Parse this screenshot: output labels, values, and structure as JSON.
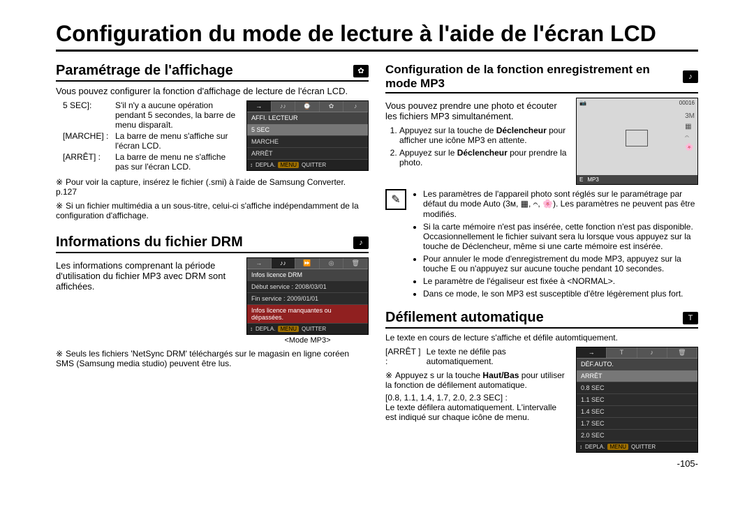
{
  "page_title": "Conﬁguration du mode de lecture à l'aide de l'écran LCD",
  "page_number": "-105-",
  "left": {
    "s1_head": "Paramétrage de l'afﬁchage",
    "s1_intro": "Vous pouvez configurer la fonction d'affichage de lecture de l'écran LCD.",
    "s1_opts": [
      {
        "lbl": "5 SEC]:",
        "val": "S'il n'y a aucune opération pendant 5 secondes, la barre de menu disparaît."
      },
      {
        "lbl": "[MARCHE] :",
        "val": "La barre de menu s'affiche sur l'écran LCD."
      },
      {
        "lbl": "[ARRÊT] :",
        "val": "La barre de menu ne s'affiche pas sur l'écran LCD."
      }
    ],
    "s1_screen": {
      "header": "AFFI. LECTEUR",
      "items": [
        "5 SEC",
        "MARCHE",
        "ARRÊT"
      ],
      "sel_index": 0,
      "footer_move": "DEPLA.",
      "footer_menu": "MENU",
      "footer_exit": "QUITTER"
    },
    "s1_notes": [
      "Pour voir la capture, insérez le fichier (.smi) à l'aide de Samsung Converter. p.127",
      "Si un fichier multimédia a un sous-titre, celui-ci s'affiche indépendamment de la configuration d'affichage."
    ],
    "s2_head": "Informations du ﬁchier DRM",
    "s2_intro": "Les informations comprenant la période d'utilisation du fichier MP3 avec DRM sont affichées.",
    "s2_screen": {
      "header": "Infos licence DRM",
      "items": [
        "Début service : 2008/03/01",
        "Fin service : 2009/01/01",
        "Infos licence manquantes ou dépassées."
      ],
      "footer_move": "DEPLA.",
      "footer_menu": "MENU",
      "footer_exit": "QUITTER"
    },
    "s2_caption": "<Mode MP3>",
    "s2_notes": [
      "Seuls les fichiers 'NetSync DRM' téléchargés sur le magasin en ligne coréen SMS (Samsung media studio) peuvent être lus."
    ]
  },
  "right": {
    "s3_head": "Conﬁguration de la fonction enregistrement en mode MP3",
    "s3_intro": "Vous pouvez prendre une photo et écouter les fichiers MP3 simultanément.",
    "s3_steps": [
      {
        "before": "Appuyez sur la touche de ",
        "bold": "Déclencheur",
        "after": " pour afficher une icône MP3 en attente."
      },
      {
        "before": "Appuyez sur le ",
        "bold": "Déclencheur",
        "after": " pour prendre la photo."
      }
    ],
    "s3_lcd": {
      "counter": "00016",
      "size": "3M",
      "bottom_e": "E",
      "bottom_mp3": "MP3"
    },
    "s3_info": [
      "Les paramètres de l'appareil photo sont réglés sur le paramétrage par défaut du mode Auto (3ᴍ, ▦, 𝄐, 🌸). Les paramètres ne peuvent pas être modifiés.",
      "Si la carte mémoire n'est pas insérée, cette fonction n'est pas disponible. Occasionnellement le fichier suivant sera lu lorsque vous appuyez sur la touche de Déclencheur, même si une carte mémoire est insérée.",
      "Pour annuler le mode d'enregistrement du mode MP3, appuyez sur la touche E ou n'appuyez sur aucune touche pendant 10 secondes.",
      "Le paramètre de l'égaliseur est fixée à <NORMAL>.",
      "Dans ce mode, le son MP3 est susceptible d'être légèrement plus fort."
    ],
    "s4_head": "Déﬁlement automatique",
    "s4_intro": "Le texte en cours de lecture s'affiche et défile automtiquement.",
    "s4_opt_lbl": "[ARRÊT ] :",
    "s4_opt_val": "Le texte ne défile pas automatiquement.",
    "s4_hint_pre": "Appuyez s ur la touche ",
    "s4_hint_bold": "Haut/Bas",
    "s4_hint_post": " pour utiliser la fonction de défilement automatique.",
    "s4_opt2_lbl": "[0.8, 1.1, 1.4, 1.7, 2.0, 2.3 SEC] :",
    "s4_opt2_val": "Le texte défilera automatiquement. L'intervalle est indiqué sur chaque icône de menu.",
    "s4_screen": {
      "header": "DÉF.AUTO.",
      "items": [
        "ARRÊT",
        "0.8 SEC",
        "1.1 SEC",
        "1.4 SEC",
        "1.7 SEC",
        "2.0 SEC"
      ],
      "sel_index": 0,
      "footer_move": "DEPLA.",
      "footer_menu": "MENU",
      "footer_exit": "QUITTER"
    }
  },
  "sym": {
    "star": "※",
    "arrows": "↕",
    "music": "♪",
    "text": "T",
    "gear": "✿",
    "note": "✎"
  }
}
